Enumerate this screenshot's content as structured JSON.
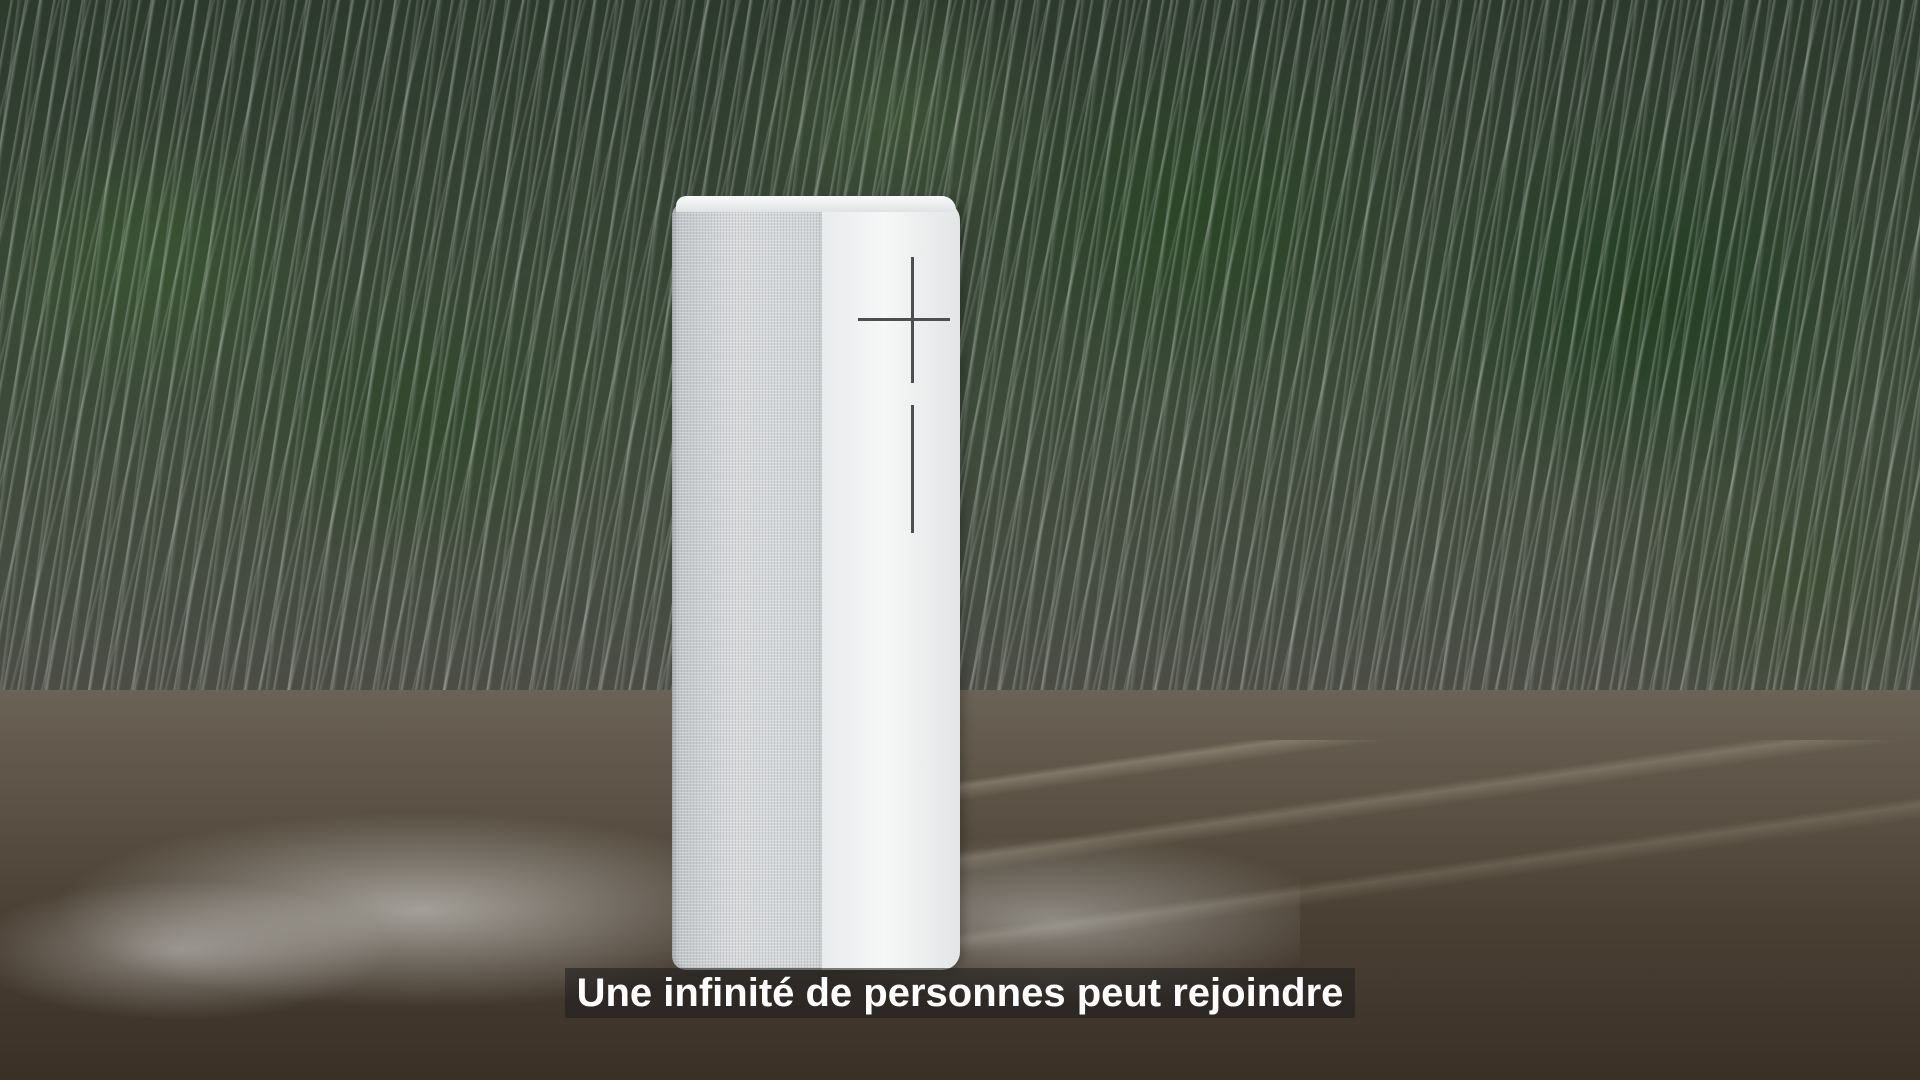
{
  "video": {
    "subtitle": "Une infinité de personnes peut rejoindre"
  },
  "scene": {
    "subject": "speaker",
    "icons": [
      "plus-icon",
      "minus-icon"
    ]
  }
}
